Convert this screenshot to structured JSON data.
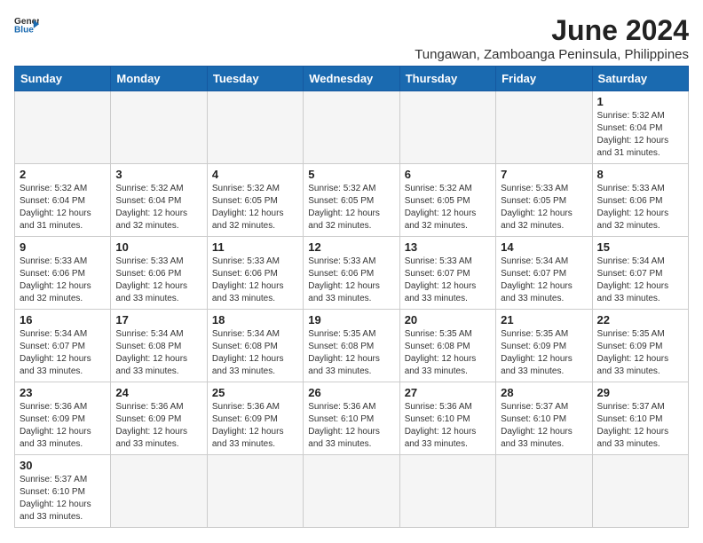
{
  "header": {
    "logo_general": "General",
    "logo_blue": "Blue",
    "title": "June 2024",
    "subtitle": "Tungawan, Zamboanga Peninsula, Philippines"
  },
  "weekdays": [
    "Sunday",
    "Monday",
    "Tuesday",
    "Wednesday",
    "Thursday",
    "Friday",
    "Saturday"
  ],
  "weeks": [
    [
      {
        "day": "",
        "info": ""
      },
      {
        "day": "",
        "info": ""
      },
      {
        "day": "",
        "info": ""
      },
      {
        "day": "",
        "info": ""
      },
      {
        "day": "",
        "info": ""
      },
      {
        "day": "",
        "info": ""
      },
      {
        "day": "1",
        "info": "Sunrise: 5:32 AM\nSunset: 6:04 PM\nDaylight: 12 hours\nand 31 minutes."
      }
    ],
    [
      {
        "day": "2",
        "info": "Sunrise: 5:32 AM\nSunset: 6:04 PM\nDaylight: 12 hours\nand 31 minutes."
      },
      {
        "day": "3",
        "info": "Sunrise: 5:32 AM\nSunset: 6:04 PM\nDaylight: 12 hours\nand 32 minutes."
      },
      {
        "day": "4",
        "info": "Sunrise: 5:32 AM\nSunset: 6:05 PM\nDaylight: 12 hours\nand 32 minutes."
      },
      {
        "day": "5",
        "info": "Sunrise: 5:32 AM\nSunset: 6:05 PM\nDaylight: 12 hours\nand 32 minutes."
      },
      {
        "day": "6",
        "info": "Sunrise: 5:32 AM\nSunset: 6:05 PM\nDaylight: 12 hours\nand 32 minutes."
      },
      {
        "day": "7",
        "info": "Sunrise: 5:33 AM\nSunset: 6:05 PM\nDaylight: 12 hours\nand 32 minutes."
      },
      {
        "day": "8",
        "info": "Sunrise: 5:33 AM\nSunset: 6:06 PM\nDaylight: 12 hours\nand 32 minutes."
      }
    ],
    [
      {
        "day": "9",
        "info": "Sunrise: 5:33 AM\nSunset: 6:06 PM\nDaylight: 12 hours\nand 32 minutes."
      },
      {
        "day": "10",
        "info": "Sunrise: 5:33 AM\nSunset: 6:06 PM\nDaylight: 12 hours\nand 33 minutes."
      },
      {
        "day": "11",
        "info": "Sunrise: 5:33 AM\nSunset: 6:06 PM\nDaylight: 12 hours\nand 33 minutes."
      },
      {
        "day": "12",
        "info": "Sunrise: 5:33 AM\nSunset: 6:06 PM\nDaylight: 12 hours\nand 33 minutes."
      },
      {
        "day": "13",
        "info": "Sunrise: 5:33 AM\nSunset: 6:07 PM\nDaylight: 12 hours\nand 33 minutes."
      },
      {
        "day": "14",
        "info": "Sunrise: 5:34 AM\nSunset: 6:07 PM\nDaylight: 12 hours\nand 33 minutes."
      },
      {
        "day": "15",
        "info": "Sunrise: 5:34 AM\nSunset: 6:07 PM\nDaylight: 12 hours\nand 33 minutes."
      }
    ],
    [
      {
        "day": "16",
        "info": "Sunrise: 5:34 AM\nSunset: 6:07 PM\nDaylight: 12 hours\nand 33 minutes."
      },
      {
        "day": "17",
        "info": "Sunrise: 5:34 AM\nSunset: 6:08 PM\nDaylight: 12 hours\nand 33 minutes."
      },
      {
        "day": "18",
        "info": "Sunrise: 5:34 AM\nSunset: 6:08 PM\nDaylight: 12 hours\nand 33 minutes."
      },
      {
        "day": "19",
        "info": "Sunrise: 5:35 AM\nSunset: 6:08 PM\nDaylight: 12 hours\nand 33 minutes."
      },
      {
        "day": "20",
        "info": "Sunrise: 5:35 AM\nSunset: 6:08 PM\nDaylight: 12 hours\nand 33 minutes."
      },
      {
        "day": "21",
        "info": "Sunrise: 5:35 AM\nSunset: 6:09 PM\nDaylight: 12 hours\nand 33 minutes."
      },
      {
        "day": "22",
        "info": "Sunrise: 5:35 AM\nSunset: 6:09 PM\nDaylight: 12 hours\nand 33 minutes."
      }
    ],
    [
      {
        "day": "23",
        "info": "Sunrise: 5:36 AM\nSunset: 6:09 PM\nDaylight: 12 hours\nand 33 minutes."
      },
      {
        "day": "24",
        "info": "Sunrise: 5:36 AM\nSunset: 6:09 PM\nDaylight: 12 hours\nand 33 minutes."
      },
      {
        "day": "25",
        "info": "Sunrise: 5:36 AM\nSunset: 6:09 PM\nDaylight: 12 hours\nand 33 minutes."
      },
      {
        "day": "26",
        "info": "Sunrise: 5:36 AM\nSunset: 6:10 PM\nDaylight: 12 hours\nand 33 minutes."
      },
      {
        "day": "27",
        "info": "Sunrise: 5:36 AM\nSunset: 6:10 PM\nDaylight: 12 hours\nand 33 minutes."
      },
      {
        "day": "28",
        "info": "Sunrise: 5:37 AM\nSunset: 6:10 PM\nDaylight: 12 hours\nand 33 minutes."
      },
      {
        "day": "29",
        "info": "Sunrise: 5:37 AM\nSunset: 6:10 PM\nDaylight: 12 hours\nand 33 minutes."
      }
    ],
    [
      {
        "day": "30",
        "info": "Sunrise: 5:37 AM\nSunset: 6:10 PM\nDaylight: 12 hours\nand 33 minutes."
      },
      {
        "day": "",
        "info": ""
      },
      {
        "day": "",
        "info": ""
      },
      {
        "day": "",
        "info": ""
      },
      {
        "day": "",
        "info": ""
      },
      {
        "day": "",
        "info": ""
      },
      {
        "day": "",
        "info": ""
      }
    ]
  ]
}
